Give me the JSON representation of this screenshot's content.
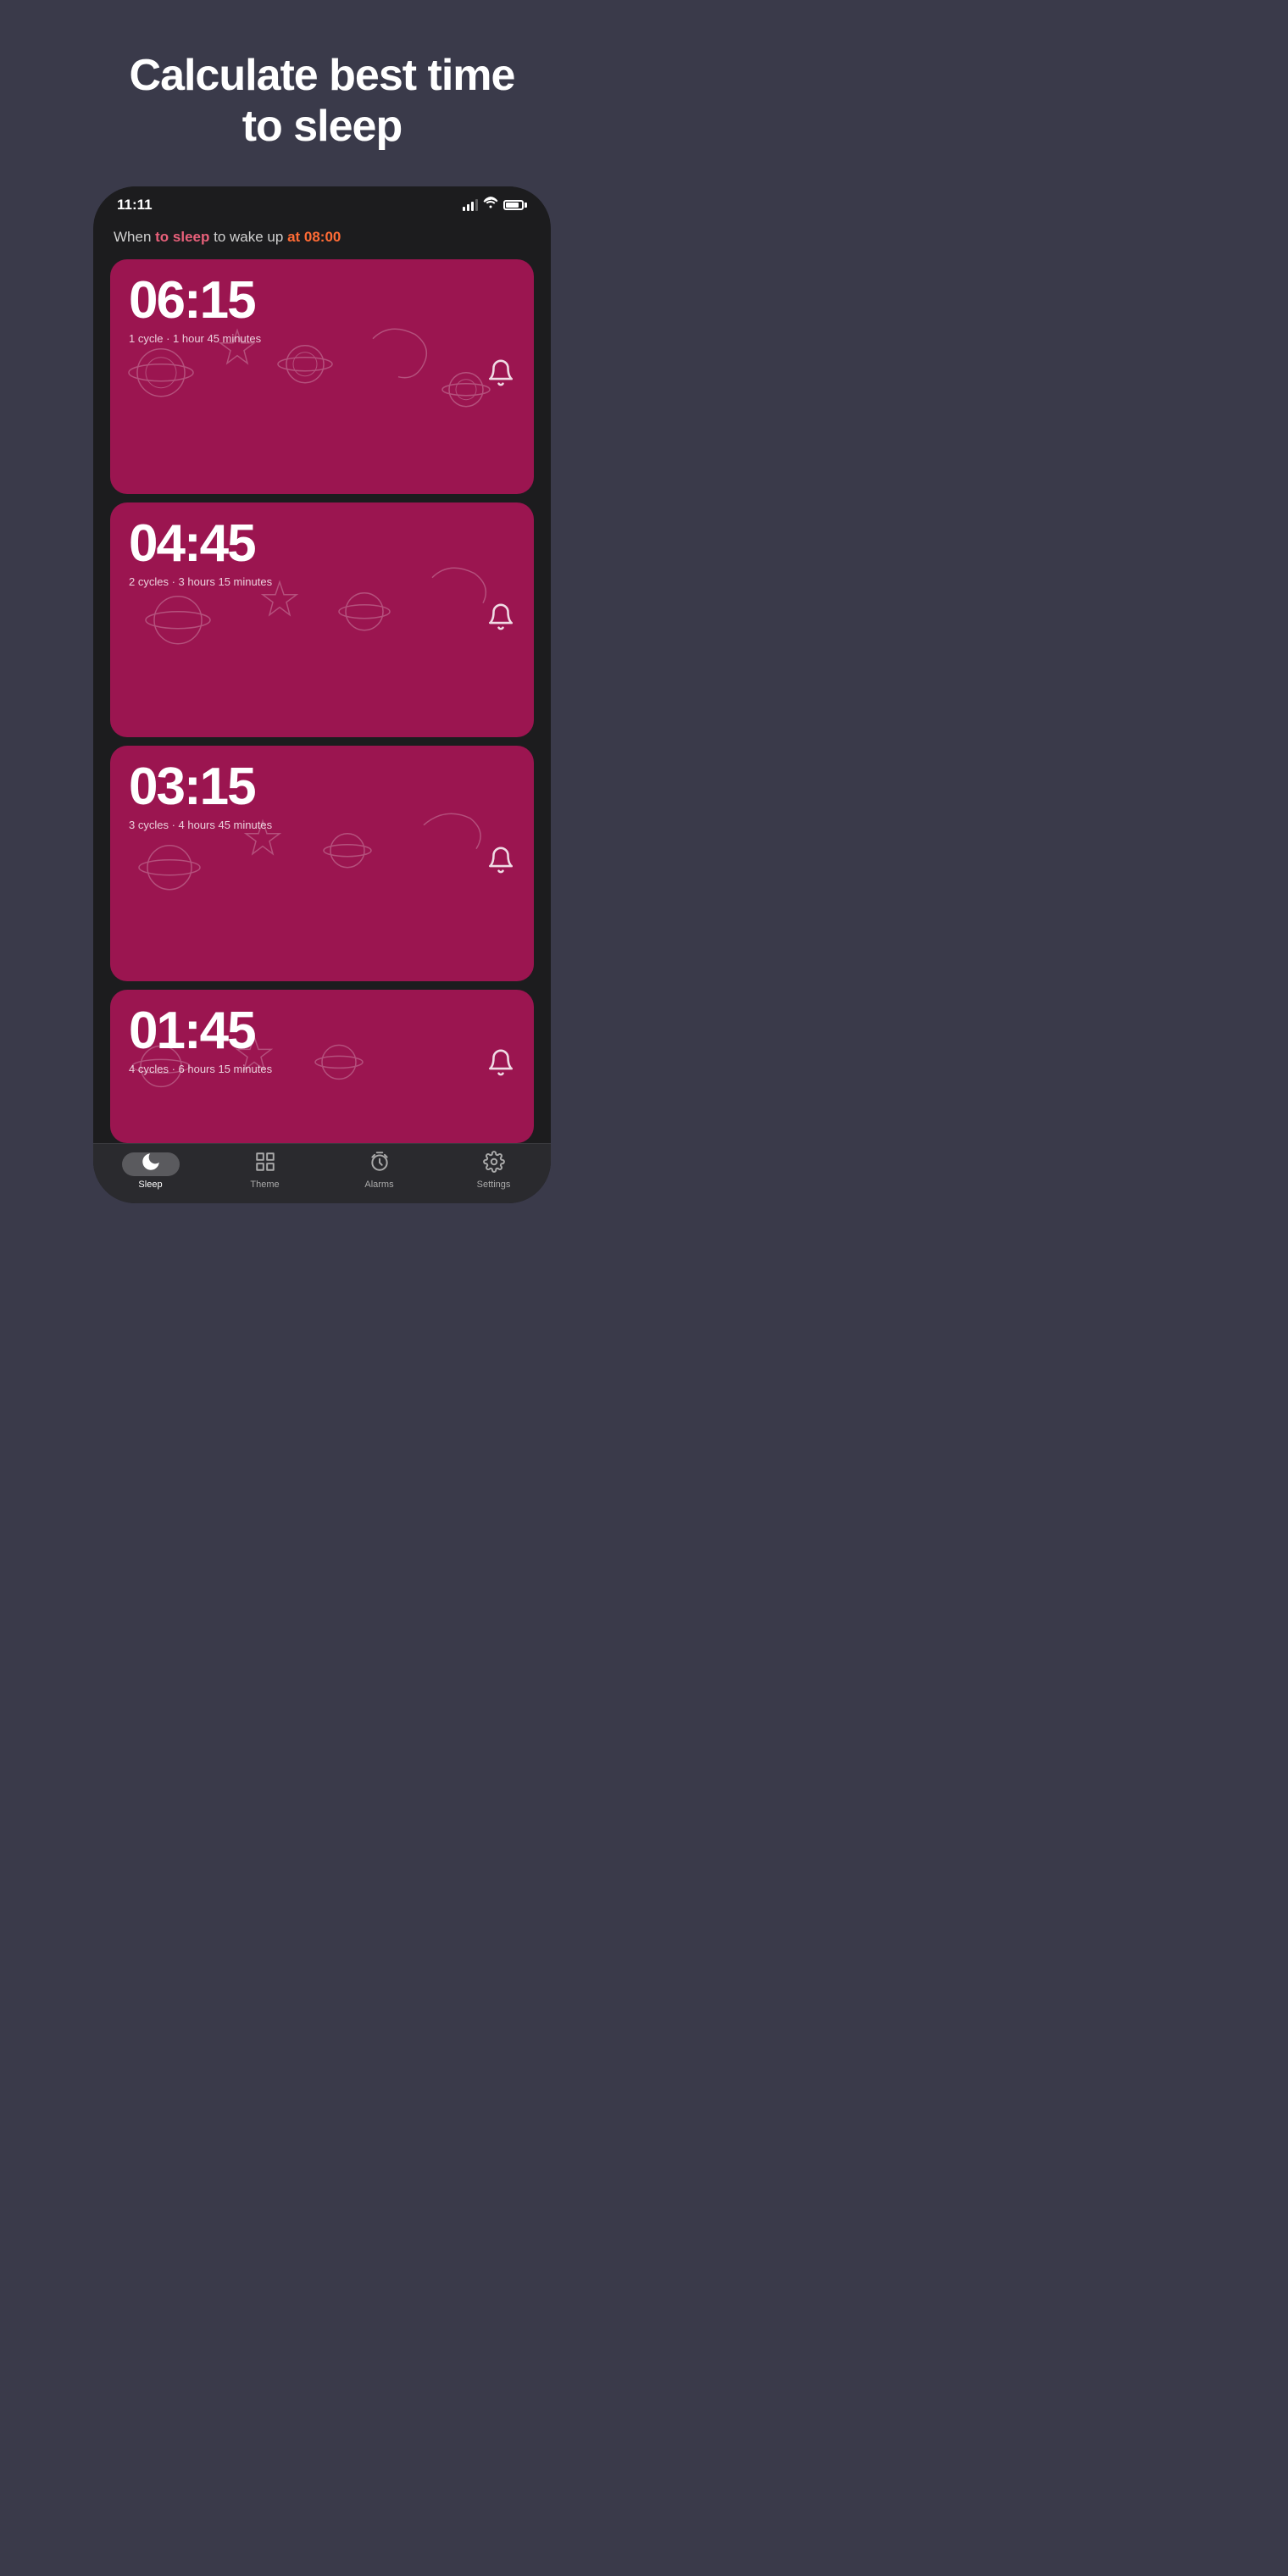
{
  "page": {
    "title": "Calculate best time\nto sleep",
    "background_color": "#3a3a4a"
  },
  "status_bar": {
    "time": "11:11",
    "signal_label": "signal",
    "wifi_label": "wifi",
    "battery_label": "battery"
  },
  "wake_header": {
    "prefix": "When ",
    "action": "to sleep",
    "middle": " to wake up ",
    "time_label": "at 08:00"
  },
  "time_cards": [
    {
      "time": "06:15",
      "cycles": "1 cycle · 1 hour 45 minutes"
    },
    {
      "time": "04:45",
      "cycles": "2 cycles · 3 hours 15 minutes"
    },
    {
      "time": "03:15",
      "cycles": "3 cycles · 4 hours 45 minutes"
    },
    {
      "time": "01:45",
      "cycles": "4 cycles · 6 hours 15 minutes"
    }
  ],
  "bottom_nav": {
    "items": [
      {
        "id": "sleep",
        "label": "Sleep",
        "active": true
      },
      {
        "id": "theme",
        "label": "Theme",
        "active": false
      },
      {
        "id": "alarms",
        "label": "Alarms",
        "active": false
      },
      {
        "id": "settings",
        "label": "Settings",
        "active": false
      }
    ]
  }
}
